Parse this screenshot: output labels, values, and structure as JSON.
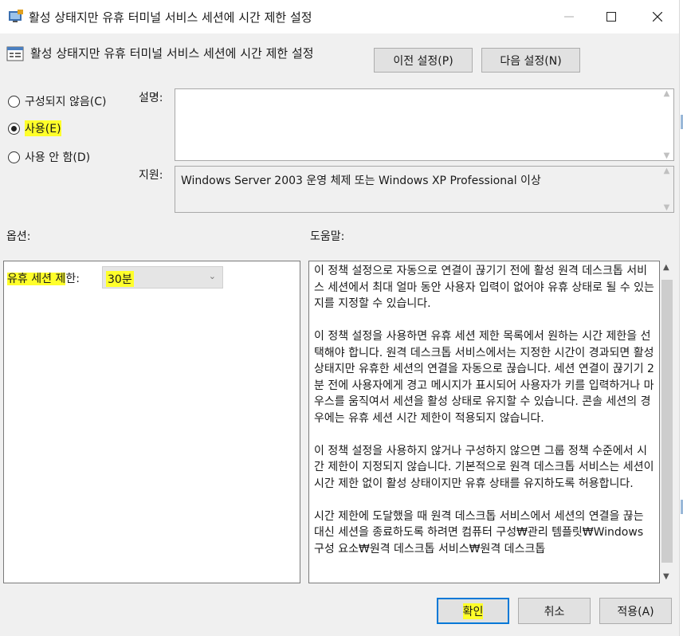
{
  "window": {
    "title": "활성 상태지만 유휴 터미널 서비스 세션에 시간 제한 설정",
    "controls": {
      "minimize_icon": "minimize-icon",
      "maximize_icon": "maximize-icon",
      "close_icon": "close-icon"
    }
  },
  "header": {
    "policy_title": "활성 상태지만 유휴 터미널 서비스 세션에 시간 제한 설정",
    "prev_button": "이전 설정(P)",
    "next_button": "다음 설정(N)"
  },
  "state": {
    "options": [
      {
        "label": "구성되지 않음(C)",
        "selected": false
      },
      {
        "label": "사용(E)",
        "selected": true
      },
      {
        "label": "사용 안 함(D)",
        "selected": false
      }
    ]
  },
  "comment": {
    "label": "설명:",
    "value": ""
  },
  "supported": {
    "label": "지원:",
    "value": "Windows Server 2003 운영 체제 또는 Windows XP Professional 이상"
  },
  "options_panel": {
    "heading": "옵션:",
    "idle_limit": {
      "label_highlighted": "유휴 세션 제",
      "label_rest": "한:",
      "value": "30분"
    }
  },
  "help_panel": {
    "heading": "도움말:",
    "paragraphs": [
      "이 정책 설정으로 자동으로 연결이 끊기기 전에 활성 원격 데스크톱 서비스 세션에서 최대 얼마 동안 사용자 입력이 없어야 유휴 상태로 될 수 있는지를 지정할 수 있습니다.",
      "이 정책 설정을 사용하면 유휴 세션 제한 목록에서 원하는 시간 제한을 선택해야 합니다. 원격 데스크톱 서비스에서는 지정한 시간이 경과되면 활성 상태지만 유휴한 세션의 연결을 자동으로 끊습니다. 세션 연결이 끊기기 2분 전에 사용자에게 경고 메시지가 표시되어 사용자가 키를 입력하거나 마우스를 움직여서 세션을 활성 상태로 유지할 수 있습니다. 콘솔 세션의 경우에는 유휴 세션 시간 제한이 적용되지 않습니다.",
      "이 정책 설정을 사용하지 않거나 구성하지 않으면 그룹 정책 수준에서 시간 제한이 지정되지 않습니다. 기본적으로 원격 데스크톱 서비스는 세션이 시간 제한 없이 활성 상태이지만 유휴 상태를 유지하도록 허용합니다.",
      "시간 제한에 도달했을 때 원격 데스크톱 서비스에서 세션의 연결을 끊는 대신 세션을 종료하도록 하려면 컴퓨터 구성₩관리 템플릿₩Windows 구성 요소₩원격 데스크톱 서비스₩원격 데스크톱"
    ]
  },
  "footer": {
    "ok_button": "확인",
    "cancel_button": "취소",
    "apply_button": "적용(A)"
  },
  "colors": {
    "highlight": "#ffff2a",
    "focus_border": "#0078d7",
    "dialog_bg": "#f0f0f0"
  }
}
